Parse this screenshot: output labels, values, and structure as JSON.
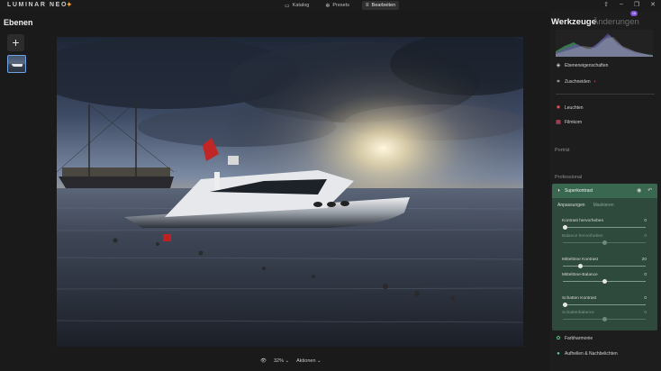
{
  "app": {
    "logo_text": "LUMINAR NEO",
    "nav": [
      {
        "label": "Katalog",
        "icon": "folder-icon",
        "active": false
      },
      {
        "label": "Presets",
        "icon": "presets-icon",
        "active": false
      },
      {
        "label": "Bearbeiten",
        "icon": "sliders-icon",
        "active": true
      }
    ]
  },
  "layers_panel": {
    "title": "Ebenen",
    "add_icon": "plus-icon"
  },
  "canvas": {
    "zoom_label": "32%",
    "actions_label": "Aktionen"
  },
  "right_panel": {
    "tab_tools": "Werkzeuge",
    "tab_changes": "Änderungen",
    "changes_badge": "16",
    "items_top": [
      {
        "label": "Ebeneneigenschaften",
        "icon": "layers-icon"
      },
      {
        "label": "Zuschneiden",
        "icon": "crop-icon"
      }
    ],
    "items_mid": [
      {
        "label": "Leuchten",
        "icon": "glow-icon",
        "color": "#e05050"
      },
      {
        "label": "Filmkorn",
        "icon": "filmgrain-icon",
        "color": "#e05070"
      }
    ],
    "section_portrait": "Porträt",
    "section_professional": "Professional",
    "super_contrast": {
      "title": "Superkontrast",
      "tab_adjust": "Anpassungen",
      "tab_masking": "Maskieren",
      "sliders": [
        {
          "label": "Kontrast hervorheben",
          "value": "0",
          "fraction": 0.0,
          "enabled": true
        },
        {
          "label": "Balance hervorheben",
          "value": "0",
          "fraction": 0.5,
          "enabled": false
        },
        {
          "label": "Mitteltöne Kontrast",
          "value": "20",
          "fraction": 0.2,
          "enabled": true
        },
        {
          "label": "Mitteltöne-Balance",
          "value": "0",
          "fraction": 0.5,
          "enabled": true
        },
        {
          "label": "Schatten Kontrast",
          "value": "0",
          "fraction": 0.0,
          "enabled": true
        },
        {
          "label": "Schattenbalance",
          "value": "0",
          "fraction": 0.5,
          "enabled": false
        }
      ]
    },
    "items_bottom": [
      {
        "label": "Farbharmonie",
        "icon": "colorharmony-icon",
        "color": "#4fd08a"
      },
      {
        "label": "Aufhellen & Nachbelichten",
        "icon": "dodgeburn-icon",
        "color": "#4fd0b0"
      }
    ],
    "accent_color": "#3a6750"
  }
}
